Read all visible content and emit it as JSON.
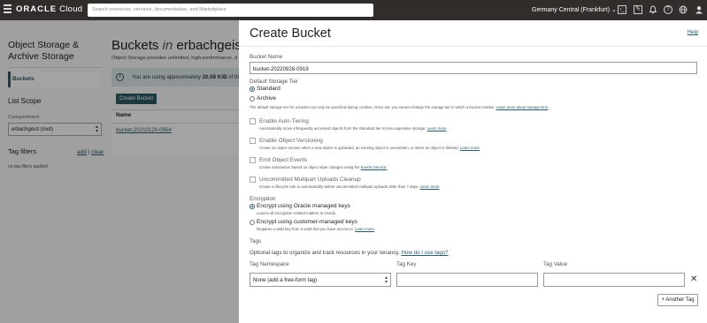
{
  "topbar": {
    "logo_brand": "ORACLE",
    "logo_product": " Cloud",
    "search_placeholder": "Search resources, services, documentation, and Marketplace",
    "region": "Germany Central (Frankfurt) ⌄",
    "icons": [
      "code-icon",
      "edit-icon",
      "bell-icon",
      "help-icon",
      "globe-icon",
      "user-icon"
    ]
  },
  "sidebar": {
    "title": "Object Storage & Archive Storage",
    "items": [
      {
        "label": "Buckets"
      }
    ],
    "list_scope": "List Scope",
    "compartment_label": "Compartment",
    "compartment_value": "erbachgeist (root)",
    "tag_filters": "Tag filters",
    "add": "add",
    "clear": "clear",
    "no_tag": "no tag filters applied"
  },
  "main": {
    "title_prefix": "Buckets",
    "title_in": "in",
    "title_name": "erbachgeist (root)",
    "subtitle": "Object Storage provides unlimited, high-performance, d",
    "banner_text_1": "You are using approximately ",
    "banner_bold": "20.08 KiB",
    "banner_text_2": " of the",
    "create_button": "Create Bucket",
    "table_header": "Name",
    "table_rows": [
      "bucket-20210120-0954"
    ]
  },
  "panel": {
    "title": "Create Bucket",
    "help": "Help",
    "bucket_name_label": "Bucket Name",
    "bucket_name_value": "bucket-20220928-0919",
    "storage_tier_label": "Default Storage Tier",
    "tier_standard": "Standard",
    "tier_archive": "Archive",
    "tier_desc": "The default storage tier for a bucket can only be specified during creation. Once set, you cannot change the storage tier in which a bucket resides.",
    "tier_link": "Learn more about storage tiers",
    "options": [
      {
        "label": "Enable Auto-Tiering",
        "desc": "Automatically move infrequently accessed objects from the Standard tier to less expensive storage.",
        "link": "Learn more"
      },
      {
        "label": "Enable Object Versioning",
        "desc": "Create an object version when a new object is uploaded, an existing object is overwritten, or when an object is deleted.",
        "link": "Learn more"
      },
      {
        "label": "Emit Object Events",
        "desc": "Create automation based on object state changes using the",
        "link": "Events Service."
      },
      {
        "label": "Uncommitted Multipart Uploads Cleanup",
        "desc": "Create a lifecycle rule to automatically delete uncommitted multipart uploads older than 7 days.",
        "link": "Learn more"
      }
    ],
    "encryption_label": "Encryption",
    "enc_oracle": "Encrypt using Oracle managed keys",
    "enc_oracle_desc": "Leaves all encryption-related matters to Oracle.",
    "enc_customer": "Encrypt using customer-managed keys",
    "enc_customer_desc": "Requires a valid key from a vault that you have access to.",
    "enc_customer_link": "Learn more",
    "tags_label": "Tags",
    "tags_optional": "Optional tags to organize and track resources in your tenancy.",
    "tags_link": "How do I use tags?",
    "tag_namespace_label": "Tag Namespace",
    "tag_key_label": "Tag Key",
    "tag_value_label": "Tag Value",
    "tag_namespace_value": "None (add a free-form tag)",
    "another_tag": "+ Another Tag"
  }
}
